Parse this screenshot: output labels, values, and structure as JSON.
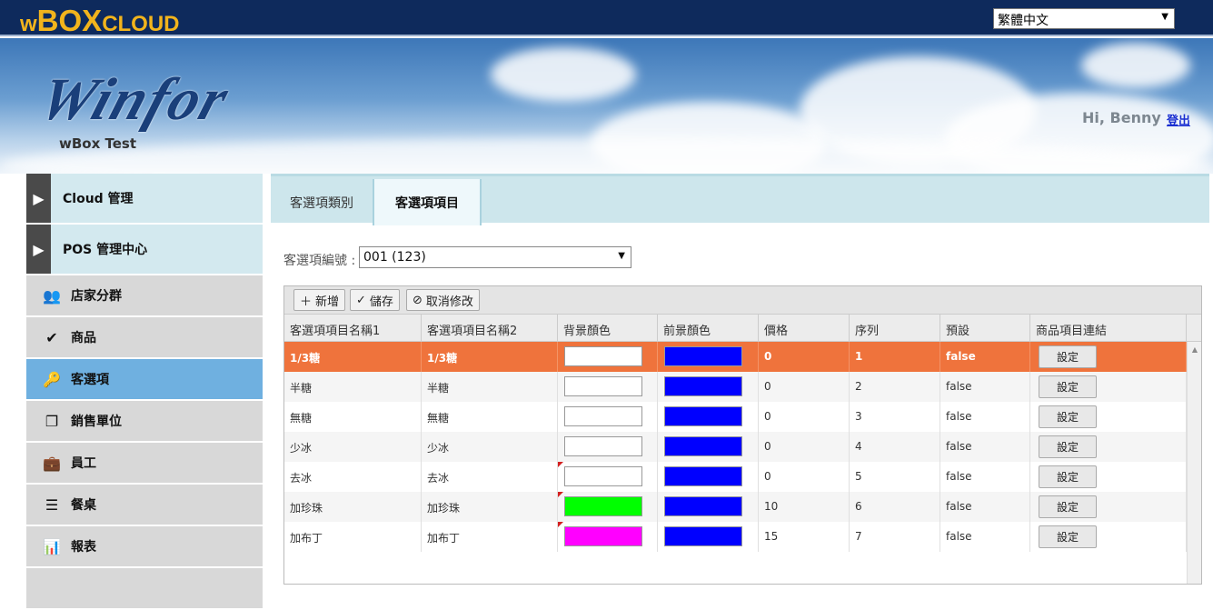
{
  "topbar": {
    "logo": {
      "w": "w",
      "b": "BOX",
      "r": "CLOUD"
    },
    "language": "繁體中文"
  },
  "banner": {
    "brand": "Winfor",
    "subtitle": "wBox Test",
    "greeting": "Hi, Benny",
    "logout": "登出"
  },
  "sidebar": {
    "groups": [
      {
        "label": "Cloud 管理"
      },
      {
        "label": "POS 管理中心"
      }
    ],
    "items": [
      {
        "label": "店家分群",
        "icon": "users-icon",
        "glyph": "👥"
      },
      {
        "label": "商品",
        "icon": "check-icon",
        "glyph": "✔"
      },
      {
        "label": "客選項",
        "icon": "key-icon",
        "glyph": "🔑"
      },
      {
        "label": "銷售單位",
        "icon": "copy-icon",
        "glyph": "❐"
      },
      {
        "label": "員工",
        "icon": "briefcase-icon",
        "glyph": "💼"
      },
      {
        "label": "餐桌",
        "icon": "list-icon",
        "glyph": "☰"
      },
      {
        "label": "報表",
        "icon": "bar-chart-icon",
        "glyph": "📊"
      }
    ]
  },
  "tabs": [
    {
      "label": "客選項類別"
    },
    {
      "label": "客選項項目"
    }
  ],
  "filter": {
    "label": "客選項編號 :",
    "value": "001 (123)"
  },
  "toolbar": {
    "add": "新增",
    "save": "儲存",
    "cancel": "取消修改"
  },
  "grid": {
    "columns": [
      "客選項項目名稱1",
      "客選項項目名稱2",
      "背景顏色",
      "前景顏色",
      "價格",
      "序列",
      "預設",
      "商品項目連結"
    ],
    "set_label": "設定",
    "rows": [
      {
        "name1": "1/3糖",
        "name2": "1/3糖",
        "bg": "#ffffff",
        "fg": "#0000ff",
        "price": "0",
        "seq": "1",
        "default": "false"
      },
      {
        "name1": "半糖",
        "name2": "半糖",
        "bg": "#ffffff",
        "fg": "#0000ff",
        "price": "0",
        "seq": "2",
        "default": "false"
      },
      {
        "name1": "無糖",
        "name2": "無糖",
        "bg": "#ffffff",
        "fg": "#0000ff",
        "price": "0",
        "seq": "3",
        "default": "false"
      },
      {
        "name1": "少冰",
        "name2": "少冰",
        "bg": "#ffffff",
        "fg": "#0000ff",
        "price": "0",
        "seq": "4",
        "default": "false"
      },
      {
        "name1": "去冰",
        "name2": "去冰",
        "bg": "#ffffff",
        "fg": "#0000ff",
        "price": "0",
        "seq": "5",
        "default": "false"
      },
      {
        "name1": "加珍珠",
        "name2": "加珍珠",
        "bg": "#00ff00",
        "fg": "#0000ff",
        "price": "10",
        "seq": "6",
        "default": "false"
      },
      {
        "name1": "加布丁",
        "name2": "加布丁",
        "bg": "#ff00ff",
        "fg": "#0000ff",
        "price": "15",
        "seq": "7",
        "default": "false"
      }
    ]
  },
  "colors": {
    "topbar": "#0e2a5c",
    "logo": "#f2b41c",
    "selected_row": "#ef733c",
    "active_nav": "#6fb0e0"
  }
}
